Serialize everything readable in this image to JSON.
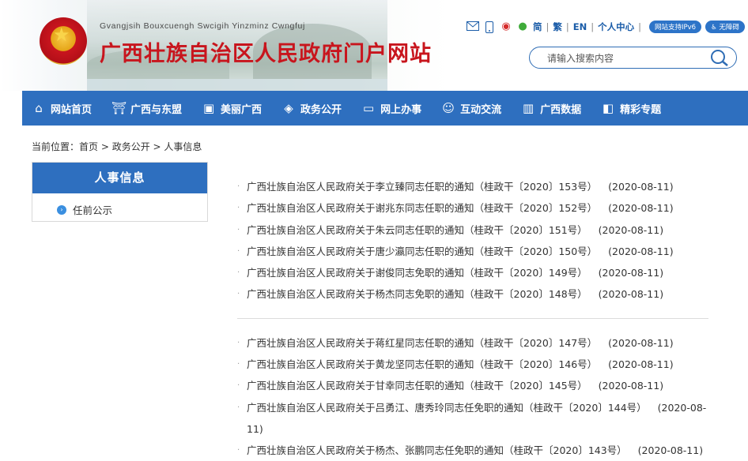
{
  "header": {
    "pinyin": "Gvangjsih Bouxcuengh Swcigih Yinzminz Cwngfuj",
    "title": "广西壮族自治区人民政府门户网站",
    "toolbar": {
      "simplified": "简",
      "traditional": "繁",
      "english": "EN",
      "personal_center": "个人中心",
      "ipv6_badge": "网站支持IPv6",
      "accessibility_badge": "无障碍"
    },
    "search": {
      "placeholder": "请输入搜索内容"
    }
  },
  "nav": {
    "items": [
      {
        "label": "网站首页",
        "icon": "home-icon"
      },
      {
        "label": "广西与东盟",
        "icon": "monument-icon"
      },
      {
        "label": "美丽广西",
        "icon": "picture-icon"
      },
      {
        "label": "政务公开",
        "icon": "layers-icon"
      },
      {
        "label": "网上办事",
        "icon": "monitor-icon"
      },
      {
        "label": "互动交流",
        "icon": "people-icon"
      },
      {
        "label": "广西数据",
        "icon": "chart-icon"
      },
      {
        "label": "精彩专题",
        "icon": "topic-icon"
      }
    ]
  },
  "breadcrumb": {
    "prefix": "当前位置：",
    "home": "首页",
    "sep1": " > ",
    "section": "政务公开",
    "sep2": " > ",
    "current": "人事信息"
  },
  "sidebar": {
    "title": "人事信息",
    "items": [
      {
        "label": "任前公示"
      }
    ]
  },
  "articles": {
    "group1": [
      {
        "title": "广西壮族自治区人民政府关于李立臻同志任职的通知（桂政干〔2020〕153号）",
        "date": "(2020-08-11)"
      },
      {
        "title": "广西壮族自治区人民政府关于谢兆东同志任职的通知（桂政干〔2020〕152号）",
        "date": "(2020-08-11)"
      },
      {
        "title": "广西壮族自治区人民政府关于朱云同志任职的通知（桂政干〔2020〕151号）",
        "date": "(2020-08-11)"
      },
      {
        "title": "广西壮族自治区人民政府关于唐少瀛同志任职的通知（桂政干〔2020〕150号）",
        "date": "(2020-08-11)"
      },
      {
        "title": "广西壮族自治区人民政府关于谢俊同志免职的通知（桂政干〔2020〕149号）",
        "date": "(2020-08-11)"
      },
      {
        "title": "广西壮族自治区人民政府关于杨杰同志免职的通知（桂政干〔2020〕148号）",
        "date": "(2020-08-11)"
      }
    ],
    "group2": [
      {
        "title": "广西壮族自治区人民政府关于蒋红星同志任职的通知（桂政干〔2020〕147号）",
        "date": "(2020-08-11)"
      },
      {
        "title": "广西壮族自治区人民政府关于黄龙坚同志任职的通知（桂政干〔2020〕146号）",
        "date": "(2020-08-11)"
      },
      {
        "title": "广西壮族自治区人民政府关于甘幸同志任职的通知（桂政干〔2020〕145号）",
        "date": "(2020-08-11)"
      },
      {
        "title": "广西壮族自治区人民政府关于吕勇江、唐秀玲同志任免职的通知（桂政干〔2020〕144号）",
        "date": "(2020-08-11)"
      },
      {
        "title": "广西壮族自治区人民政府关于杨杰、张鹏同志任免职的通知（桂政干〔2020〕143号）",
        "date": "(2020-08-11)"
      }
    ]
  }
}
